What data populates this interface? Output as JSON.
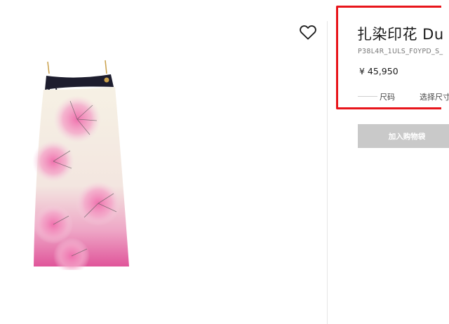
{
  "product": {
    "title": "扎染印花 Du",
    "sku": "P38L4R_1ULS_F0YPD_S_",
    "price": "¥ 45,950",
    "size_label": "尺码",
    "size_select": "选择尺寸",
    "add_to_bag": "加入购物袋"
  },
  "icons": {
    "wishlist": "heart-outline-icon"
  },
  "colors": {
    "highlight_border": "#e8151b",
    "add_to_bag_bg": "#c9c9c9",
    "dress_pink": "#e0559a",
    "dress_base": "#f6f1e4",
    "strap": "#1d1d2e"
  }
}
